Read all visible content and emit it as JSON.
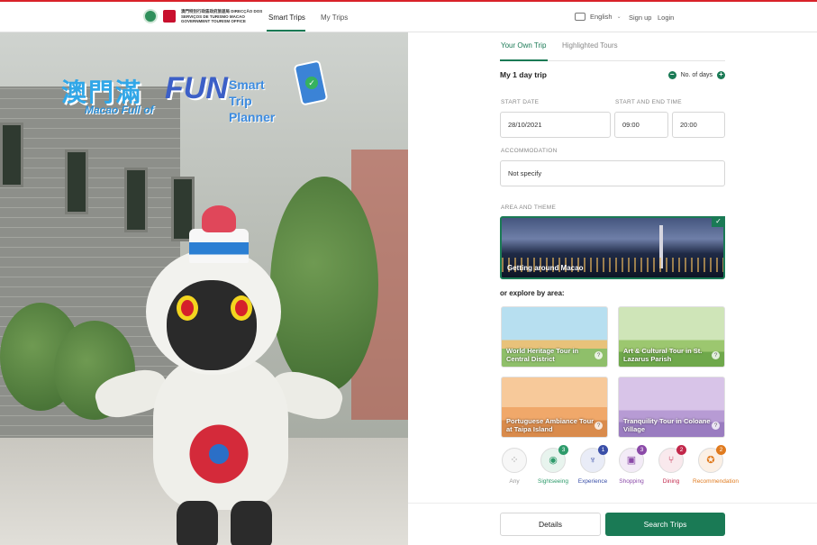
{
  "header": {
    "logo_text": "澳門特別行政區政府旅遊局 DIRECÇÃO DOS SERVIÇOS DE TURISMO MACAO GOVERNMENT TOURISM OFFICE",
    "nav": [
      {
        "label": "Smart Trips",
        "active": true
      },
      {
        "label": "My Trips",
        "active": false
      }
    ],
    "language": "English",
    "signup": "Sign up",
    "login": "Login"
  },
  "hero": {
    "title_chinese": "澳門滿",
    "title_sub": "Macao Full of",
    "title_fun": "FUN",
    "title_planner_line1": "Smart Trip",
    "title_planner_line2": "Planner"
  },
  "planner": {
    "tabs": [
      {
        "label": "Your Own Trip",
        "active": true,
        "color": "#1a7a55"
      },
      {
        "label": "Highlighted Tours",
        "active": false,
        "color": "#888888"
      }
    ],
    "trip_name": "My 1 day trip",
    "days_label": "No. of days",
    "start_date_label": "START DATE",
    "start_end_time_label": "START AND END TIME",
    "start_date": "28/10/2021",
    "start_time": "09:00",
    "end_time": "20:00",
    "accommodation_label": "ACCOMMODATION",
    "accommodation_value": "Not specify",
    "area_theme_label": "AREA AND THEME",
    "theme_selected": "Getting around Macao",
    "explore_label": "or explore by area:",
    "areas": [
      {
        "label": "World Heritage Tour in Central District"
      },
      {
        "label": "Art & Cultural Tour in St. Lazarus Parish"
      },
      {
        "label": "Portuguese Ambiance Tour at Taipa Island"
      },
      {
        "label": "Tranquility Tour in Coloane Village"
      }
    ],
    "categories": [
      {
        "label": "Any",
        "badge": "",
        "color": "#999999",
        "icon": "grid-icon"
      },
      {
        "label": "Sightseeing",
        "badge": "3",
        "color": "#2e9b6b",
        "icon": "camera-icon"
      },
      {
        "label": "Experience",
        "badge": "1",
        "color": "#3a4fa8",
        "icon": "person-icon"
      },
      {
        "label": "Shopping",
        "badge": "3",
        "color": "#8b4aa8",
        "icon": "shopping-icon"
      },
      {
        "label": "Dining",
        "badge": "2",
        "color": "#c2274a",
        "icon": "dining-icon"
      },
      {
        "label": "Recommendation",
        "badge": "2",
        "color": "#e07b1f",
        "icon": "award-icon"
      }
    ],
    "details_button": "Details",
    "search_button": "Search Trips"
  },
  "colors": {
    "accent": "#1a7a55",
    "top_line": "#d9222a"
  }
}
